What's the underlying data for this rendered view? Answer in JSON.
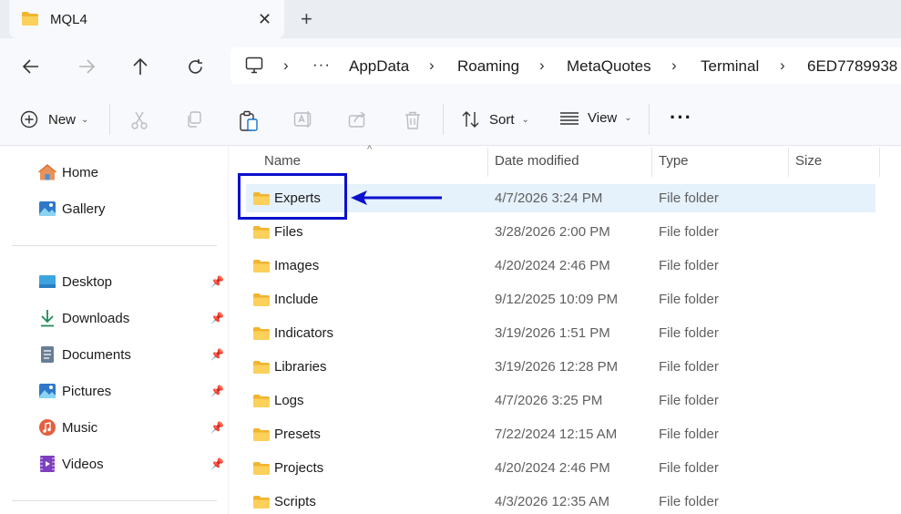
{
  "tab": {
    "title": "MQL4",
    "close": "✕",
    "new": "+"
  },
  "address": {
    "ellipsis": "···",
    "crumbs": [
      "AppData",
      "Roaming",
      "MetaQuotes",
      "Terminal",
      "6ED7789938"
    ]
  },
  "toolbar": {
    "new_label": "New",
    "sort_label": "Sort",
    "view_label": "View",
    "more": "···"
  },
  "sidebar": {
    "items": [
      {
        "label": "Home"
      },
      {
        "label": "Gallery"
      },
      {
        "label": "Desktop"
      },
      {
        "label": "Downloads"
      },
      {
        "label": "Documents"
      },
      {
        "label": "Pictures"
      },
      {
        "label": "Music"
      },
      {
        "label": "Videos"
      }
    ]
  },
  "columns": {
    "name": "Name",
    "date": "Date modified",
    "type": "Type",
    "size": "Size"
  },
  "files": [
    {
      "name": "Experts",
      "date": "4/7/2026 3:24 PM",
      "type": "File folder"
    },
    {
      "name": "Files",
      "date": "3/28/2026 2:00 PM",
      "type": "File folder"
    },
    {
      "name": "Images",
      "date": "4/20/2024 2:46 PM",
      "type": "File folder"
    },
    {
      "name": "Include",
      "date": "9/12/2025 10:09 PM",
      "type": "File folder"
    },
    {
      "name": "Indicators",
      "date": "3/19/2026 1:51 PM",
      "type": "File folder"
    },
    {
      "name": "Libraries",
      "date": "3/19/2026 12:28 PM",
      "type": "File folder"
    },
    {
      "name": "Logs",
      "date": "4/7/2026 3:25 PM",
      "type": "File folder"
    },
    {
      "name": "Presets",
      "date": "7/22/2024 12:15 AM",
      "type": "File folder"
    },
    {
      "name": "Projects",
      "date": "4/20/2024 2:46 PM",
      "type": "File folder"
    },
    {
      "name": "Scripts",
      "date": "4/3/2026 12:35 AM",
      "type": "File folder"
    }
  ],
  "colors": {
    "annotation": "#0b10cc",
    "folder": "#f8c74a",
    "selection": "#e5f1fb"
  }
}
